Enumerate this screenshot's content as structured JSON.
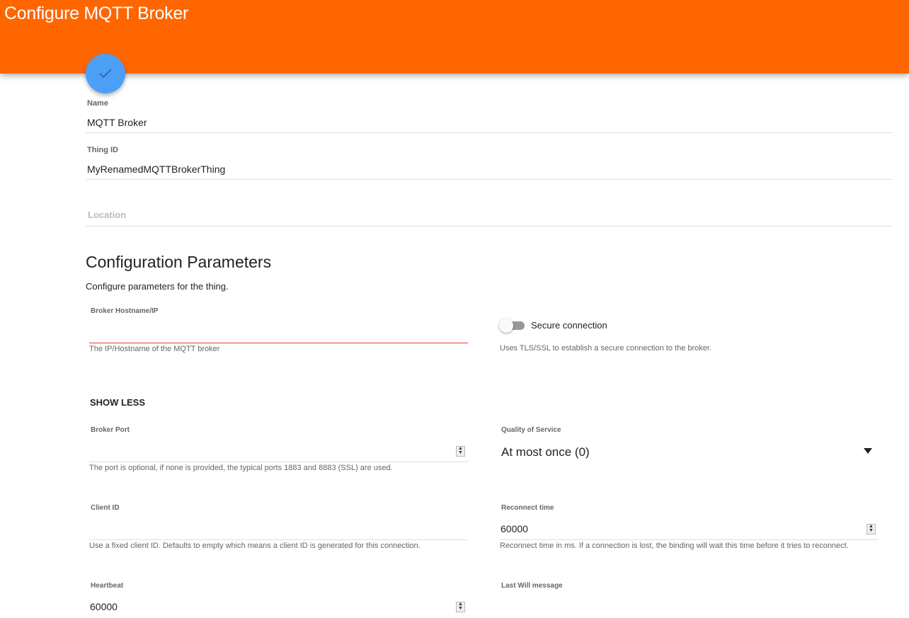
{
  "header": {
    "title": "Configure MQTT Broker",
    "accent": "#ff6600"
  },
  "save_fab": {
    "icon": "check-icon"
  },
  "thing": {
    "name_label": "Name",
    "name_value": "MQTT Broker",
    "id_label": "Thing ID",
    "id_value": "MyRenamedMQTTBrokerThing",
    "location_placeholder": "Location"
  },
  "config": {
    "heading": "Configuration Parameters",
    "subtitle": "Configure parameters for the thing.",
    "host": {
      "label": "Broker Hostname/IP",
      "value": "",
      "hint": "The IP/Hostname of the MQTT broker"
    },
    "secure": {
      "label": "Secure connection",
      "enabled": false,
      "hint": "Uses TLS/SSL to establish a secure connection to the broker."
    },
    "show_less": "SHOW LESS",
    "port": {
      "label": "Broker Port",
      "value": "",
      "hint": "The port is optional, if none is provided, the typical ports 1883 and 8883 (SSL) are used."
    },
    "qos": {
      "label": "Quality of Service",
      "value": "At most once (0)"
    },
    "client_id": {
      "label": "Client ID",
      "value": "",
      "hint": "Use a fixed client ID. Defaults to empty which means a client ID is generated for this connection."
    },
    "reconnect": {
      "label": "Reconnect time",
      "value": "60000",
      "hint": "Reconnect time in ms. If a connection is lost, the binding will wait this time before it tries to reconnect."
    },
    "heartbeat": {
      "label": "Heartbeat",
      "value": "60000"
    },
    "last_will": {
      "label": "Last Will message"
    }
  }
}
